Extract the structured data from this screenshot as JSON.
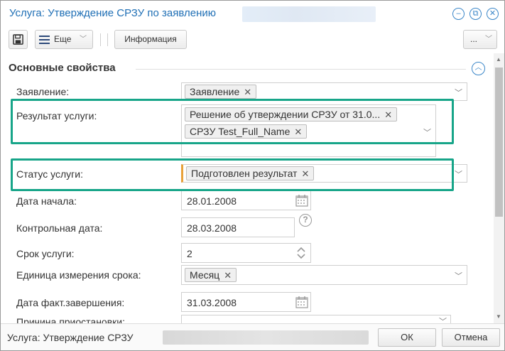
{
  "window": {
    "title": "Услуга: Утверждение СРЗУ по заявлению"
  },
  "toolbar": {
    "more_label": "Еще",
    "info_label": "Информация",
    "overflow_label": "..."
  },
  "section": {
    "title": "Основные свойства"
  },
  "fields": {
    "application": {
      "label": "Заявление:",
      "tag": "Заявление"
    },
    "service_result": {
      "label": "Результат услуги:",
      "tags": [
        "Решение об утверждении СРЗУ от 31.0...",
        "СРЗУ Test_Full_Name"
      ]
    },
    "service_status": {
      "label": "Статус услуги:",
      "tag": "Подготовлен результат"
    },
    "start_date": {
      "label": "Дата начала:",
      "value": "28.01.2008"
    },
    "control_date": {
      "label": "Контрольная дата:",
      "value": "28.03.2008"
    },
    "service_term": {
      "label": "Срок услуги:",
      "value": "2"
    },
    "term_unit": {
      "label": "Единица измерения срока:",
      "tag": "Месяц"
    },
    "actual_end_date": {
      "label": "Дата факт.завершения:",
      "value": "31.03.2008"
    },
    "suspension_reason": {
      "label": "Причина приостановки:"
    }
  },
  "footer": {
    "status_text": "Услуга: Утверждение СРЗУ",
    "ok_label": "ОК",
    "cancel_label": "Отмена"
  },
  "colors": {
    "accent": "#1f6fb5",
    "highlight": "#17a589",
    "required_marker": "#e8a13a"
  }
}
